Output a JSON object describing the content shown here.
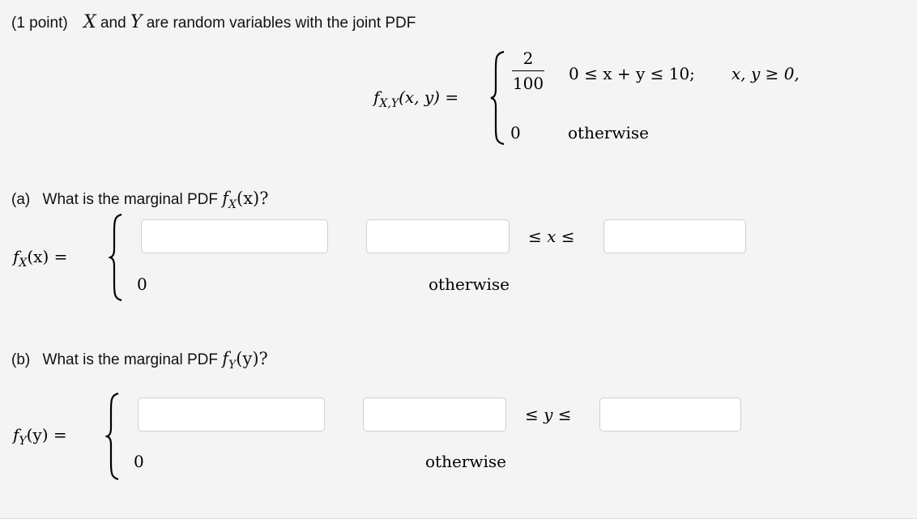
{
  "intro": {
    "points": "(1 point)",
    "var_x": "X",
    "and": "and",
    "var_y": "Y",
    "text": "are random variables with the joint PDF"
  },
  "joint_pdf": {
    "lhs_f": "f",
    "lhs_sub": "X,Y",
    "lhs_args": "(x, y) =",
    "case1_num": "2",
    "case1_den": "100",
    "case1_cond": "0 ≤ x + y ≤ 10;",
    "case1_cond2": "x, y ≥ 0,",
    "case2_val": "0",
    "case2_cond": "otherwise"
  },
  "part_a": {
    "label": "(a)",
    "question": "What is the marginal PDF",
    "q_f": "f",
    "q_sub": "X",
    "q_args": "(x)?",
    "lhs_f": "f",
    "lhs_sub": "X",
    "lhs_args": "(x) =",
    "ineq": "≤ x ≤",
    "zero": "0",
    "otherwise": "otherwise",
    "pdf_input": {
      "value": "",
      "placeholder": ""
    },
    "lower_input": {
      "value": "",
      "placeholder": ""
    },
    "upper_input": {
      "value": "",
      "placeholder": ""
    }
  },
  "part_b": {
    "label": "(b)",
    "question": "What is the marginal PDF",
    "q_f": "f",
    "q_sub": "Y",
    "q_args": "(y)?",
    "lhs_f": "f",
    "lhs_sub": "Y",
    "lhs_args": "(y) =",
    "ineq": "≤ y ≤",
    "zero": "0",
    "otherwise": "otherwise",
    "pdf_input": {
      "value": "",
      "placeholder": ""
    },
    "lower_input": {
      "value": "",
      "placeholder": ""
    },
    "upper_input": {
      "value": "",
      "placeholder": ""
    }
  }
}
